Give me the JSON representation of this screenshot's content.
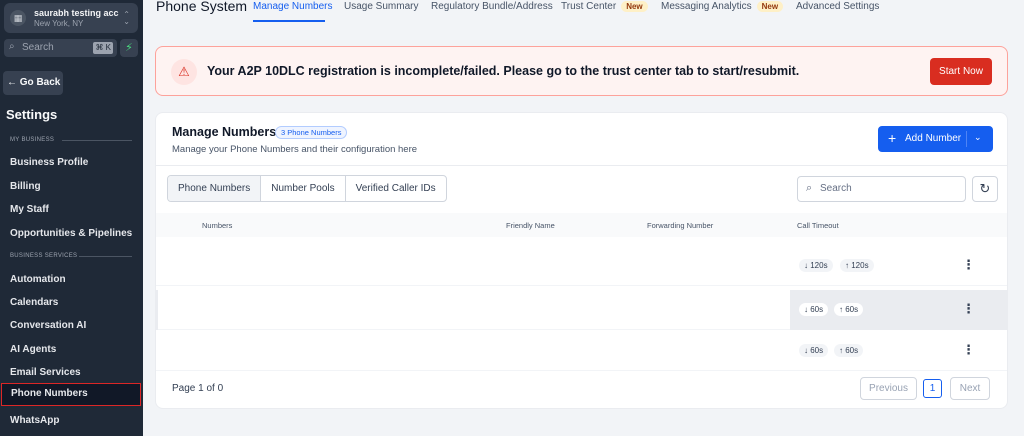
{
  "sidebar": {
    "account": {
      "name": "saurabh testing acc",
      "location": "New York, NY",
      "avatar_icon": "building-icon"
    },
    "search": {
      "placeholder": "Search",
      "shortcut": "⌘ K"
    },
    "go_back": "← Go Back",
    "title": "Settings",
    "section_my_business": "MY BUSINESS",
    "section_business_services": "BUSINESS SERVICES",
    "my_business_items": [
      "Business Profile",
      "Billing",
      "My Staff",
      "Opportunities & Pipelines"
    ],
    "business_services_items": [
      "Automation",
      "Calendars",
      "Conversation AI",
      "AI Agents",
      "Email Services",
      "Phone Numbers",
      "WhatsApp"
    ],
    "active_item": "Phone Numbers"
  },
  "topbar": {
    "title": "Phone System",
    "tabs": [
      {
        "label": "Manage Numbers",
        "active": true,
        "new": false
      },
      {
        "label": "Usage Summary",
        "active": false,
        "new": false
      },
      {
        "label": "Regulatory Bundle/Address",
        "active": false,
        "new": false
      },
      {
        "label": "Trust Center",
        "active": false,
        "new": true
      },
      {
        "label": "Messaging Analytics",
        "active": false,
        "new": true
      },
      {
        "label": "Advanced Settings",
        "active": false,
        "new": false
      }
    ],
    "new_badge": "New"
  },
  "alert": {
    "message": "Your A2P 10DLC registration is incomplete/failed. Please go to the trust center tab to start/resubmit.",
    "button": "Start Now",
    "icon": "warning-triangle-icon"
  },
  "card": {
    "title": "Manage Numbers",
    "count_badge": "3 Phone Numbers",
    "subtitle": "Manage your Phone Numbers and their configuration here",
    "add_button": "Add Number",
    "segments": [
      "Phone Numbers",
      "Number Pools",
      "Verified Caller IDs"
    ],
    "active_segment": "Phone Numbers",
    "search_placeholder": "Search",
    "columns": [
      "Numbers",
      "Friendly Name",
      "Forwarding Number",
      "Call Timeout"
    ],
    "rows": [
      {
        "inbound": "↓ 120s",
        "outbound": "↑ 120s",
        "highlighted": false
      },
      {
        "inbound": "↓ 60s",
        "outbound": "↑ 60s",
        "highlighted": true
      },
      {
        "inbound": "↓ 60s",
        "outbound": "↑ 60s",
        "highlighted": false
      }
    ],
    "pagination": {
      "text": "Page 1 of 0",
      "previous": "Previous",
      "page": "1",
      "next": "Next"
    }
  },
  "colors": {
    "primary": "#155eef",
    "danger": "#d92d20",
    "sidebar_bg": "#1f2937"
  }
}
